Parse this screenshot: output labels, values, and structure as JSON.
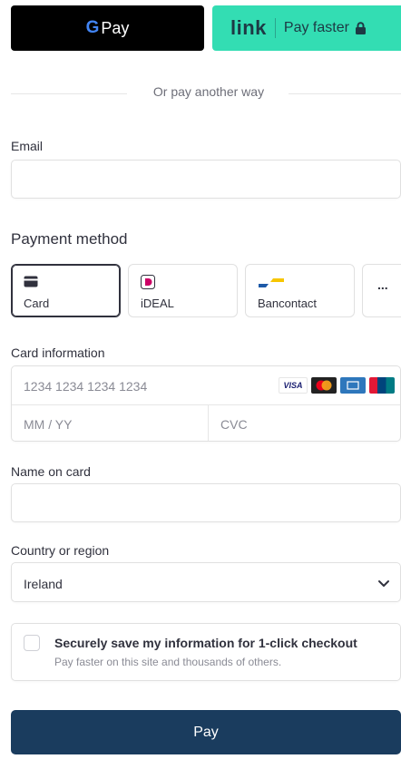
{
  "wallets": {
    "gpay_g": "G",
    "gpay_label": "Pay",
    "link_logo": "link",
    "link_label": "Pay faster"
  },
  "divider": {
    "text": "Or pay another way"
  },
  "email": {
    "label": "Email",
    "value": "",
    "placeholder": ""
  },
  "payment_method": {
    "title": "Payment method",
    "options": [
      {
        "label": "Card",
        "icon": "card-icon",
        "selected": true
      },
      {
        "label": "iDEAL",
        "icon": "ideal-icon",
        "selected": false
      },
      {
        "label": "Bancontact",
        "icon": "bancontact-icon",
        "selected": false
      },
      {
        "label": "...",
        "icon": "more-icon",
        "selected": false
      }
    ]
  },
  "card_info": {
    "label": "Card information",
    "number_placeholder": "1234 1234 1234 1234",
    "expiry_placeholder": "MM / YY",
    "cvc_placeholder": "CVC",
    "brands": [
      "VISA",
      "mastercard",
      "amex",
      "unionpay"
    ]
  },
  "name_on_card": {
    "label": "Name on card",
    "value": ""
  },
  "country": {
    "label": "Country or region",
    "value": "Ireland"
  },
  "save_info": {
    "title": "Securely save my information for 1-click checkout",
    "subtitle": "Pay faster on this site and thousands of others.",
    "checked": false
  },
  "pay_button": {
    "label": "Pay"
  },
  "colors": {
    "link_green": "#33ddb3",
    "pay_button": "#1a3c5e",
    "text": "#30313d",
    "muted": "#8a8b95"
  }
}
